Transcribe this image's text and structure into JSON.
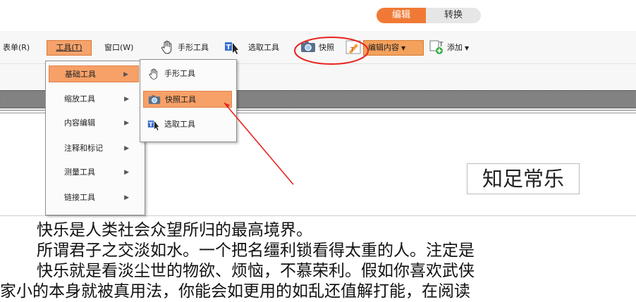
{
  "mode_tabs": {
    "edit": "编辑",
    "convert": "转换"
  },
  "toolbar": {
    "form": "表单(R)",
    "tools": "工具(T)",
    "window": "窗口(W)",
    "hand_tool": "手形工具",
    "select_tool": "选取工具",
    "snapshot": "快照",
    "edit_content": "编辑内容",
    "add": "添加"
  },
  "tools_menu": [
    {
      "label": "基础工具",
      "active": true
    },
    {
      "label": "缩放工具",
      "active": false
    },
    {
      "label": "内容编辑",
      "active": false
    },
    {
      "label": "注释和标记",
      "active": false
    },
    {
      "label": "测量工具",
      "active": false
    },
    {
      "label": "链接工具",
      "active": false
    }
  ],
  "basic_submenu": [
    {
      "label": "手形工具",
      "icon": "hand-icon",
      "active": false
    },
    {
      "label": "快照工具",
      "icon": "camera-icon",
      "active": true
    },
    {
      "label": "选取工具",
      "icon": "text-select-icon",
      "active": false
    }
  ],
  "document": {
    "boxed_text": "知足常乐",
    "lines": [
      "快乐是人类社会众望所归的最高境界。",
      "所谓君子之交淡如水。一个把名缰利锁看得太重的人。注定是",
      "快乐就是看淡尘世的物欲、烦恼，不慕荣利。假如你喜欢武侠",
      "家小的本身就被真用法，你能会如更用的如乱还值解打能，在阅读"
    ]
  },
  "colors": {
    "accent": "#f07a35",
    "annotation": "#e8231f",
    "menu_active": "#f7a067"
  }
}
